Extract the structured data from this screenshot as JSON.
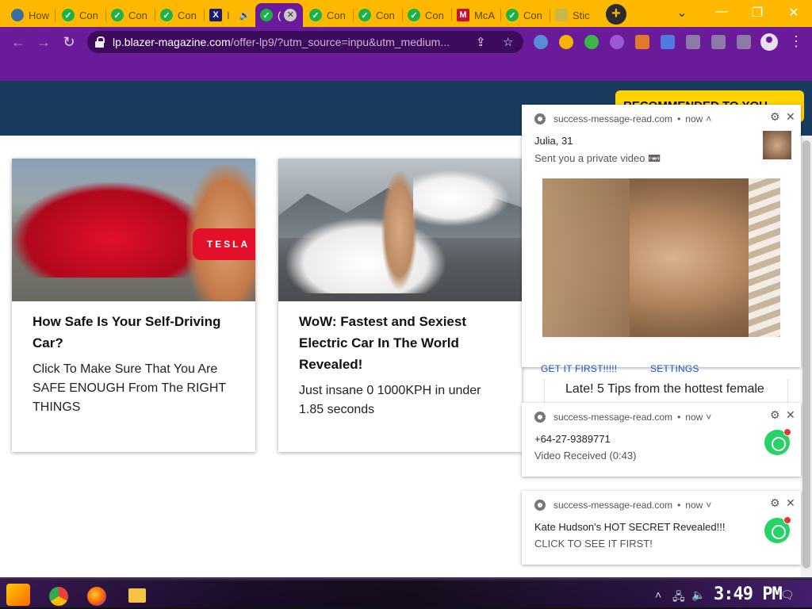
{
  "tabs": [
    {
      "label": "How",
      "icon": "python-icon"
    },
    {
      "label": "Con",
      "icon": "check-icon"
    },
    {
      "label": "Con",
      "icon": "check-icon"
    },
    {
      "label": "Con",
      "icon": "check-icon"
    },
    {
      "label": "I",
      "icon": "x-icon"
    },
    {
      "label": "(",
      "icon": "check-icon",
      "active": true
    },
    {
      "label": "Con",
      "icon": "check-icon"
    },
    {
      "label": "Con",
      "icon": "check-icon"
    },
    {
      "label": "Con",
      "icon": "check-icon"
    },
    {
      "label": "McA",
      "icon": "mcafee-icon"
    },
    {
      "label": "Con",
      "icon": "check-icon"
    },
    {
      "label": "Stic",
      "icon": "sticky-icon"
    }
  ],
  "toolbar": {
    "url_host": "lp.blazer-magazine.com",
    "url_rest": "/offer-lp9/?utm_source=inpu&utm_medium..."
  },
  "page": {
    "recommended_label": "RECOMMENDED TO YOU",
    "cards": [
      {
        "title": "How Safe Is Your Self-Driving Car?",
        "desc": "Click To Make Sure That You Are SAFE ENOUGH From The RIGHT THINGS",
        "shirt_text": "TESLA"
      },
      {
        "title": "WoW: Fastest and Sexiest Electric Car In The World Revealed!",
        "desc": "Just insane 0 1000KPH in under 1.85 seconds"
      }
    ],
    "card3_peek": "Late! 5 Tips from the hottest female"
  },
  "notifications": [
    {
      "source": "success-message-read.com",
      "dot": "•",
      "time": "now",
      "title": "Julia, 31",
      "body": "Sent you a private video 📼",
      "button_primary": "GET IT FIRST!!!!!",
      "button_secondary": "SETTINGS"
    },
    {
      "source": "success-message-read.com",
      "dot": "•",
      "time": "now",
      "title": "+64-27-9389771",
      "body": "Video Received (0:43)"
    },
    {
      "source": "success-message-read.com",
      "dot": "•",
      "time": "now",
      "title": "Kate Hudson's HOT SECRET Revealed!!!",
      "body": "CLICK TO SEE IT FIRST!"
    }
  ],
  "taskbar": {
    "clock": "3:49 PM"
  },
  "colors": {
    "tabstrip": "#FFB800",
    "toolbar": "#6a1b9a",
    "navy": "#183b5e",
    "recommend": "#ffd200",
    "link": "#1a56c9"
  }
}
